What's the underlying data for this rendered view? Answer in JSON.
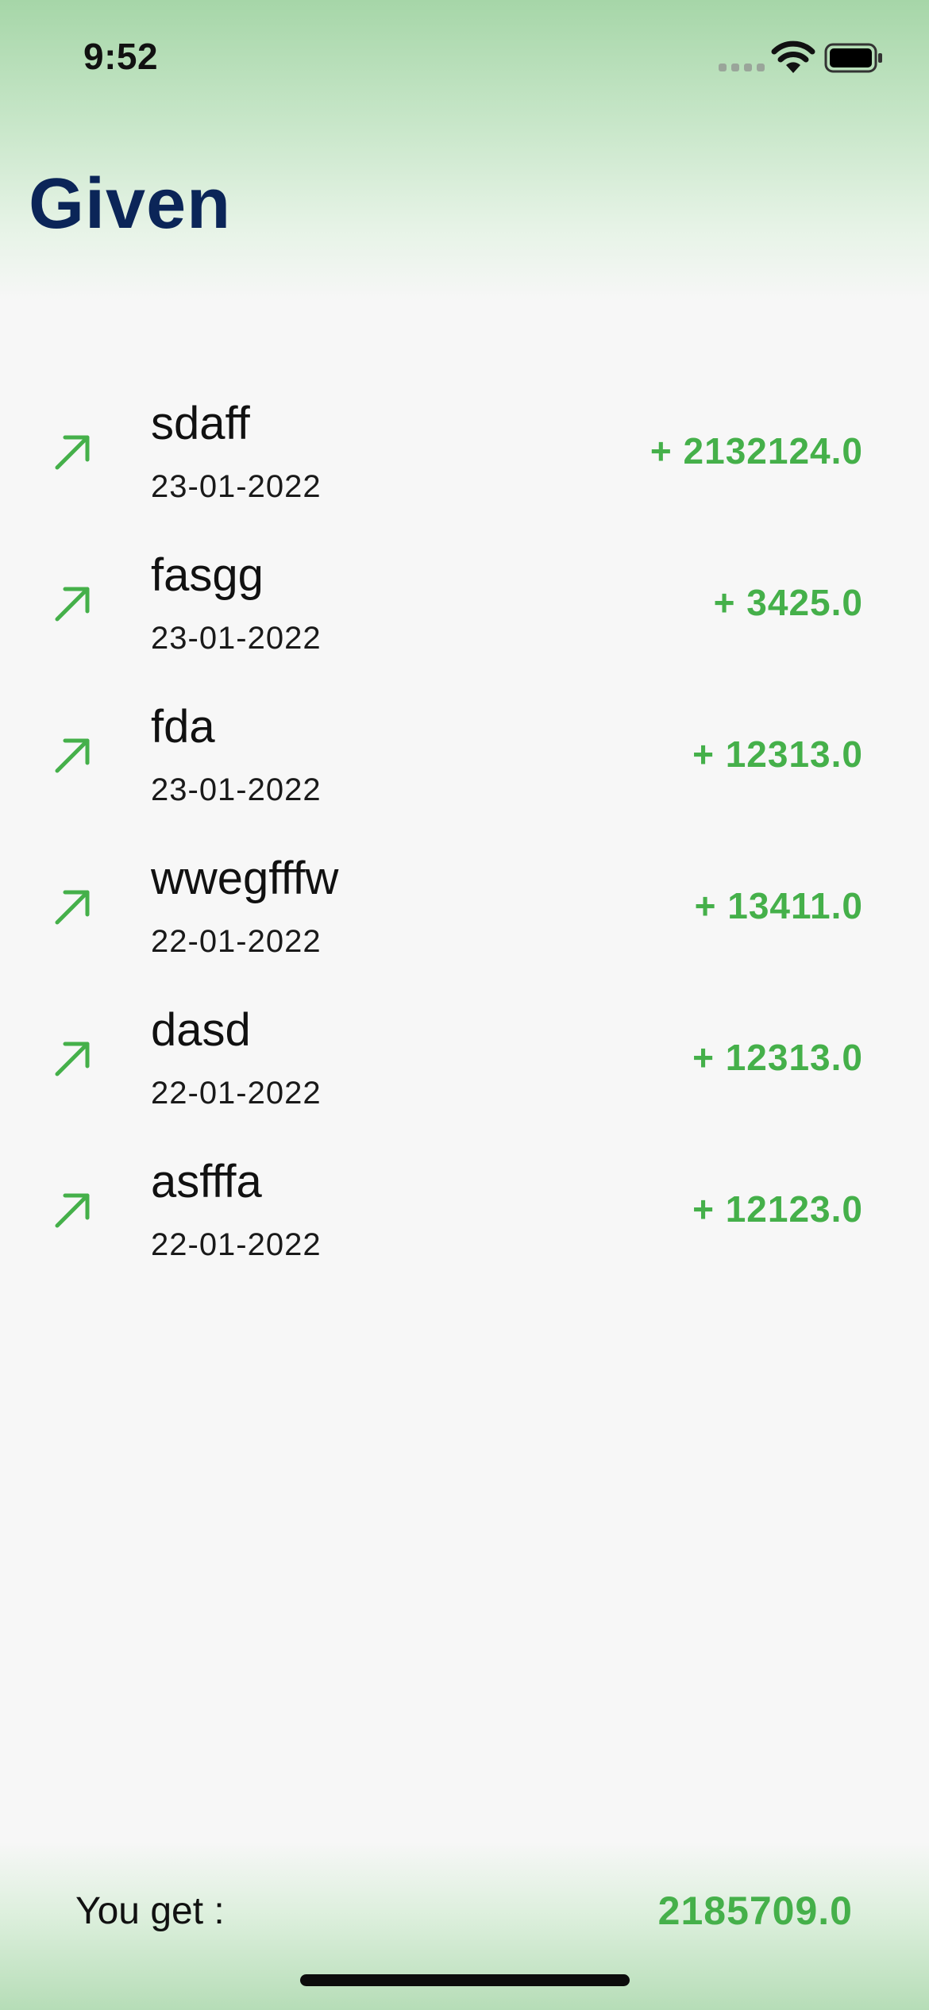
{
  "status_bar": {
    "time": "9:52",
    "signal_icon": "cellular-signal-icon",
    "wifi_icon": "wifi-icon",
    "battery_icon": "battery-icon"
  },
  "header": {
    "title": "Given"
  },
  "transactions": [
    {
      "name": "sdaff",
      "date": "23-01-2022",
      "amount": "+ 2132124.0",
      "icon": "arrow-up-right-icon"
    },
    {
      "name": "fasgg",
      "date": "23-01-2022",
      "amount": "+ 3425.0",
      "icon": "arrow-up-right-icon"
    },
    {
      "name": "fda",
      "date": "23-01-2022",
      "amount": "+ 12313.0",
      "icon": "arrow-up-right-icon"
    },
    {
      "name": "wwegfffw",
      "date": "22-01-2022",
      "amount": "+ 13411.0",
      "icon": "arrow-up-right-icon"
    },
    {
      "name": "dasd",
      "date": "22-01-2022",
      "amount": "+ 12313.0",
      "icon": "arrow-up-right-icon"
    },
    {
      "name": "asfffa",
      "date": "22-01-2022",
      "amount": "+ 12123.0",
      "icon": "arrow-up-right-icon"
    }
  ],
  "footer": {
    "label": "You get :",
    "total": "2185709.0"
  },
  "colors": {
    "title": "#0b2558",
    "accent_green": "#45b04a",
    "header_gradient": "#a6d6a8",
    "background": "#f7f7f7"
  }
}
